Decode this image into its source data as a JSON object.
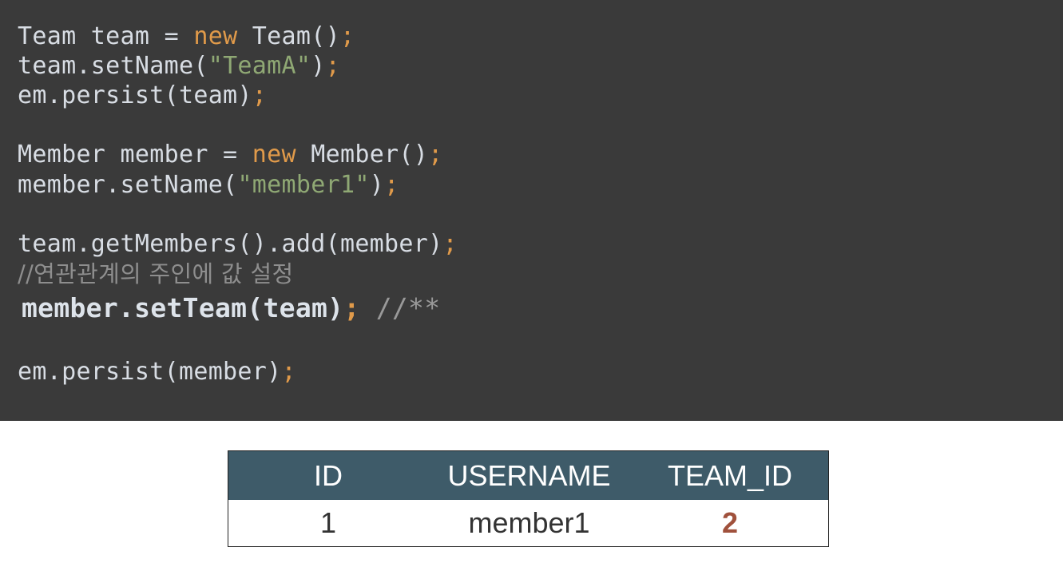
{
  "code": {
    "l1_a": "Team team = ",
    "l1_kw": "new",
    "l1_b": " Team()",
    "l1_semi": ";",
    "l2_a": "team.setName(",
    "l2_str": "\"TeamA\"",
    "l2_b": ")",
    "l2_semi": ";",
    "l3_a": "em.persist(team)",
    "l3_semi": ";",
    "l4_a": "Member member = ",
    "l4_kw": "new",
    "l4_b": " Member()",
    "l4_semi": ";",
    "l5_a": "member.setName(",
    "l5_str": "\"member1\"",
    "l5_b": ")",
    "l5_semi": ";",
    "l6_a": "team.getMembers().add(member)",
    "l6_semi": ";",
    "l7_comment": "//연관관계의 주인에 값 설정",
    "l8_a": "member.setTeam(team)",
    "l8_semi": ";",
    "l8_comment": " //**",
    "l9_a": "em.persist(member)",
    "l9_semi": ";"
  },
  "table": {
    "headers": [
      "ID",
      "USERNAME",
      "TEAM_ID"
    ],
    "rows": [
      [
        "1",
        "member1",
        "2"
      ]
    ],
    "highlight_color": "#a0513c",
    "header_bg": "#3e5b69"
  },
  "colors": {
    "code_bg": "#3a3a3a",
    "keyword": "#e09a4a",
    "string": "#8fa874",
    "comment": "#8e8e8e"
  }
}
